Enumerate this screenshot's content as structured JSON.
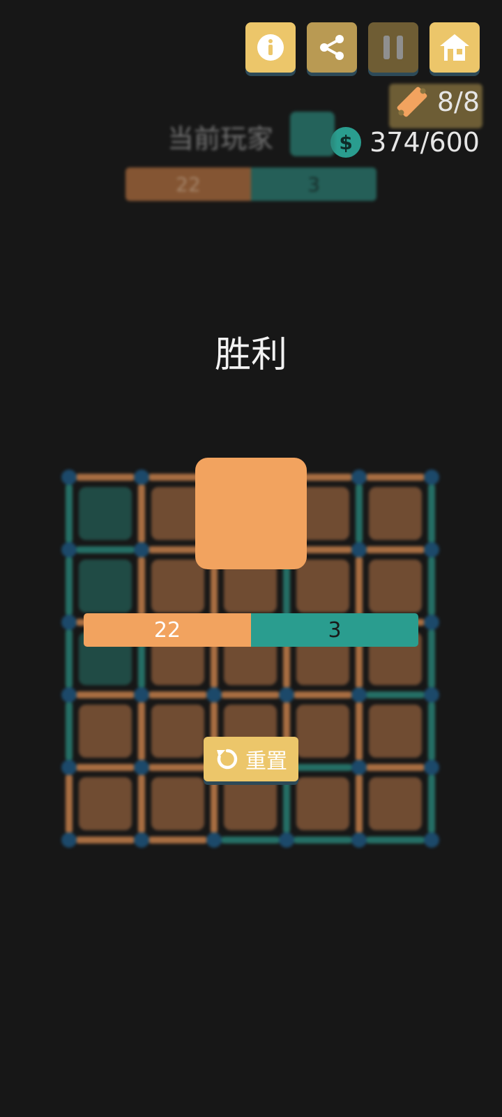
{
  "toolbar": {
    "buttons": [
      {
        "name": "info-button",
        "icon": "info-icon"
      },
      {
        "name": "share-button",
        "icon": "share-icon"
      },
      {
        "name": "pause-button",
        "icon": "pause-icon"
      },
      {
        "name": "home-button",
        "icon": "home-icon"
      }
    ]
  },
  "stats": {
    "tickets": "8/8",
    "ticket_icon": "ticket-icon",
    "coins": "374/600",
    "coin_symbol": "$"
  },
  "header": {
    "current_player_label": "当前玩家",
    "current_player_color": "#2a8478"
  },
  "result": {
    "title": "胜利"
  },
  "scores": {
    "player1": "22",
    "player2": "3"
  },
  "reset": {
    "label": "重置",
    "icon": "refresh-icon"
  },
  "colors": {
    "player1": "#f2a35f",
    "player2": "#2a9d8f",
    "dot": "#1e5a86",
    "button": "#ecc66a"
  },
  "board": {
    "size": 5,
    "cells": [
      [
        "p2",
        "p1",
        "p1",
        "p1",
        "p1"
      ],
      [
        "p2",
        "p1",
        "p1",
        "p1",
        "p1"
      ],
      [
        "p2",
        "p1",
        "p1",
        "p1",
        "p1"
      ],
      [
        "p1",
        "p1",
        "p1",
        "p1",
        "p1"
      ],
      [
        "p1",
        "p1",
        "p1",
        "p1",
        "p1"
      ]
    ],
    "h_lines": [
      [
        "p1",
        "p1",
        "p1",
        "p1",
        "p1"
      ],
      [
        "p2",
        "p1",
        "p1",
        "p1",
        "p1"
      ],
      [
        "p1",
        "p1",
        "p1",
        "p1",
        "p1"
      ],
      [
        "p1",
        "p1",
        "p1",
        "p1",
        "p2"
      ],
      [
        "p1",
        "p1",
        "p1",
        "p2",
        "p1"
      ],
      [
        "p1",
        "p1",
        "p2",
        "p2",
        "p2"
      ]
    ],
    "v_lines": [
      [
        "p2",
        "p1",
        "p1",
        "p1",
        "p2",
        "p2"
      ],
      [
        "p2",
        "p1",
        "p1",
        "p2",
        "p1",
        "p2"
      ],
      [
        "p2",
        "p2",
        "p1",
        "p1",
        "p1",
        "p2"
      ],
      [
        "p2",
        "p1",
        "p1",
        "p1",
        "p1",
        "p2"
      ],
      [
        "p1",
        "p1",
        "p1",
        "p2",
        "p1",
        "p2"
      ]
    ]
  }
}
